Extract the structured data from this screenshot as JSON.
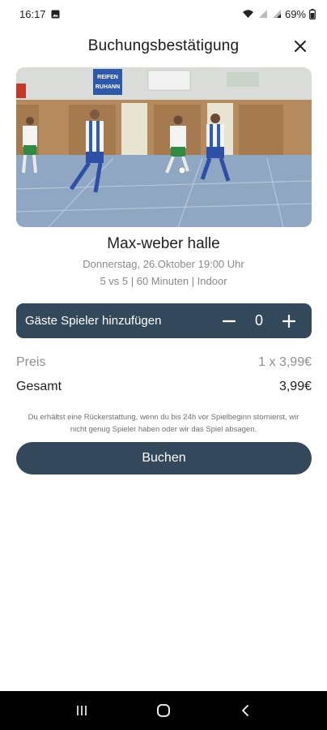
{
  "status_bar": {
    "time": "16:17",
    "battery": "69%"
  },
  "header": {
    "title": "Buchungsbestätigung"
  },
  "hero": {
    "banner_text": "REIFEN RUHANN"
  },
  "venue": {
    "name": "Max-weber halle",
    "date": "Donnerstag, 26.Oktober 19:00 Uhr",
    "format": "5 vs 5 | 60 Minuten | Indoor"
  },
  "guests": {
    "label": "Gäste Spieler hinzufügen",
    "minus": "−",
    "plus": "+",
    "count": "0"
  },
  "price": {
    "preis_label": "Preis",
    "preis_value": "1 x 3,99€",
    "gesamt_label": "Gesamt",
    "gesamt_value": "3,99€"
  },
  "refund_note": "Du erhältst eine Rückerstattung, wenn du bis 24h vor Spielbeginn stornierst, wir nicht genug Spieler haben oder wir das Spiel absagen.",
  "book_button": "Buchen",
  "colors": {
    "primary": "#34485b",
    "muted_text": "#8a8a8a"
  }
}
